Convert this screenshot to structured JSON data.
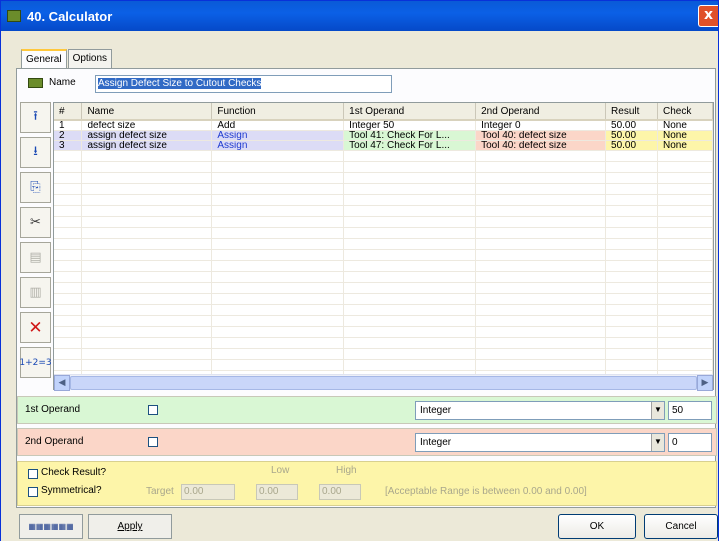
{
  "window": {
    "title": "40. Calculator",
    "close_label": "x"
  },
  "tabs": [
    {
      "label": "General"
    },
    {
      "label": "Options"
    }
  ],
  "name_field": {
    "label": "Name",
    "value": "Assign Defect Size to Cutout Checks"
  },
  "table": {
    "columns": [
      "#",
      "Name",
      "Function",
      "1st Operand",
      "2nd Operand",
      "Result",
      "Check"
    ],
    "rows": [
      {
        "num": "1",
        "name": "defect size",
        "function": "Add",
        "op1": "Integer 50",
        "op2": "Integer 0",
        "result": "50.00",
        "check": "None"
      },
      {
        "num": "2",
        "name": "assign defect size",
        "function": "Assign",
        "op1": "Tool 41: Check For L...",
        "op2": "Tool 40: defect size",
        "result": "50.00",
        "check": "None"
      },
      {
        "num": "3",
        "name": "assign defect size",
        "function": "Assign",
        "op1": "Tool 47: Check For L...",
        "op2": "Tool 40: defect size",
        "result": "50.00",
        "check": "None"
      }
    ]
  },
  "operand1": {
    "label": "1st Operand",
    "type": "Integer",
    "value": "50",
    "color": "#d9f7d4"
  },
  "operand2": {
    "label": "2nd Operand",
    "type": "Integer",
    "value": "0",
    "color": "#fbd6c8"
  },
  "check": {
    "check_result_label": "Check Result?",
    "symmetrical_label": "Symmetrical?",
    "low_label": "Low",
    "high_label": "High",
    "target_label": "Target",
    "target_value": "0.00",
    "low_value": "0.00",
    "high_value": "0.00",
    "range_text": "[Acceptable Range is between 0.00 and 0.00]",
    "color": "#fdf5a9"
  },
  "buttons": {
    "apply": "Apply",
    "ok": "OK",
    "cancel": "Cancel"
  },
  "colors": {
    "title_bar": "#0b5fe3",
    "row_assign": "#dcdcf6",
    "op1_cell": "#d9f7d4",
    "op2_cell": "#fbd6c8",
    "check_cell": "#fdf5a9",
    "assign_text": "#1f3bd0"
  }
}
